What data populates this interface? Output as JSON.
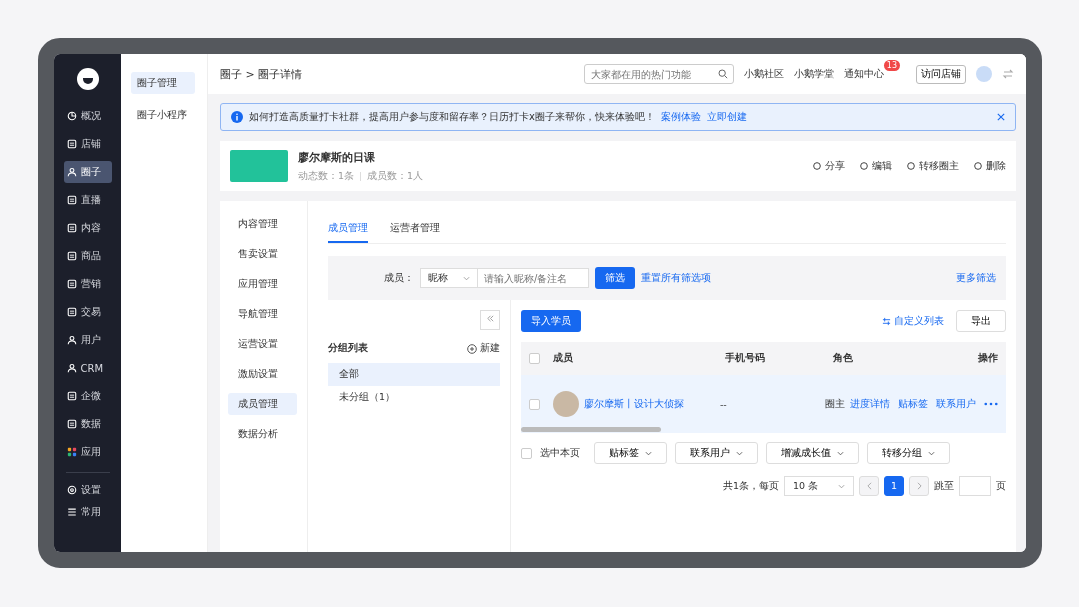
{
  "sidebar": {
    "items": [
      {
        "label": "概况",
        "selected": false
      },
      {
        "label": "店铺",
        "selected": false
      },
      {
        "label": "圈子",
        "selected": true
      },
      {
        "label": "直播",
        "selected": false
      },
      {
        "label": "内容",
        "selected": false
      },
      {
        "label": "商品",
        "selected": false
      },
      {
        "label": "营销",
        "selected": false
      },
      {
        "label": "交易",
        "selected": false
      },
      {
        "label": "用户",
        "selected": false
      },
      {
        "label": "CRM",
        "selected": false
      },
      {
        "label": "企微",
        "selected": false
      },
      {
        "label": "数据",
        "selected": false
      },
      {
        "label": "应用",
        "selected": false
      }
    ],
    "bottom_items": [
      {
        "label": "设置"
      },
      {
        "label": "常用"
      }
    ]
  },
  "subnav": {
    "items": [
      {
        "label": "圈子管理",
        "selected": true
      },
      {
        "label": "圈子小程序",
        "selected": false
      }
    ]
  },
  "topbar": {
    "breadcrumb": "圈子 > 圈子详情",
    "search_placeholder": "大家都在用的热门功能",
    "links": [
      "小鹅社区",
      "小鹅学堂",
      "通知中心"
    ],
    "notification_badge": "13",
    "visit_button": "访问店铺"
  },
  "alert": {
    "text": "如何打造高质量打卡社群，提高用户参与度和留存率？日历打卡x圈子来帮你，快来体验吧！",
    "links": [
      "案例体验",
      "立即创建"
    ]
  },
  "circle": {
    "name": "廖尔摩斯的日课",
    "stats": "动态数：1条",
    "members": "成员数：1人",
    "actions": [
      "分享",
      "编辑",
      "转移圈主",
      "删除"
    ]
  },
  "detail_nav": [
    {
      "label": "内容管理",
      "selected": false
    },
    {
      "label": "售卖设置",
      "selected": false
    },
    {
      "label": "应用管理",
      "selected": false
    },
    {
      "label": "导航管理",
      "selected": false
    },
    {
      "label": "运营设置",
      "selected": false
    },
    {
      "label": "激励设置",
      "selected": false
    },
    {
      "label": "成员管理",
      "selected": true
    },
    {
      "label": "数据分析",
      "selected": false
    }
  ],
  "tabs": [
    {
      "label": "成员管理",
      "selected": true
    },
    {
      "label": "运营者管理",
      "selected": false
    }
  ],
  "filter": {
    "label": "成员：",
    "select_value": "昵称",
    "placeholder": "请输入昵称/备注名",
    "filter_button": "筛选",
    "reset_link": "重置所有筛选项",
    "more_link": "更多筛选"
  },
  "groups": {
    "title": "分组列表",
    "new_button": "新建",
    "items": [
      {
        "label": "全部",
        "selected": true
      },
      {
        "label": "未分组（1）",
        "selected": false
      }
    ]
  },
  "toolbar": {
    "import_button": "导入学员",
    "custom_columns": "自定义列表",
    "export_button": "导出"
  },
  "table": {
    "header_checked": false,
    "columns": [
      "成员",
      "手机号码",
      "角色",
      "操作"
    ],
    "rows": [
      {
        "checked": false,
        "member": "廖尔摩斯丨设计大侦探",
        "phone": "--",
        "role": "圈主",
        "actions": [
          "进度详情",
          "贴标签",
          "联系用户"
        ]
      }
    ]
  },
  "bulk": {
    "select_page": "选中本页",
    "checked": false,
    "buttons": [
      "贴标签",
      "联系用户",
      "增减成长值",
      "转移分组"
    ]
  },
  "pagination": {
    "total": "共1条，每页",
    "page_size": "10 条",
    "pages": [
      {
        "label": "1",
        "selected": true
      }
    ],
    "jump_label": "跳至",
    "page_suffix": "页"
  }
}
